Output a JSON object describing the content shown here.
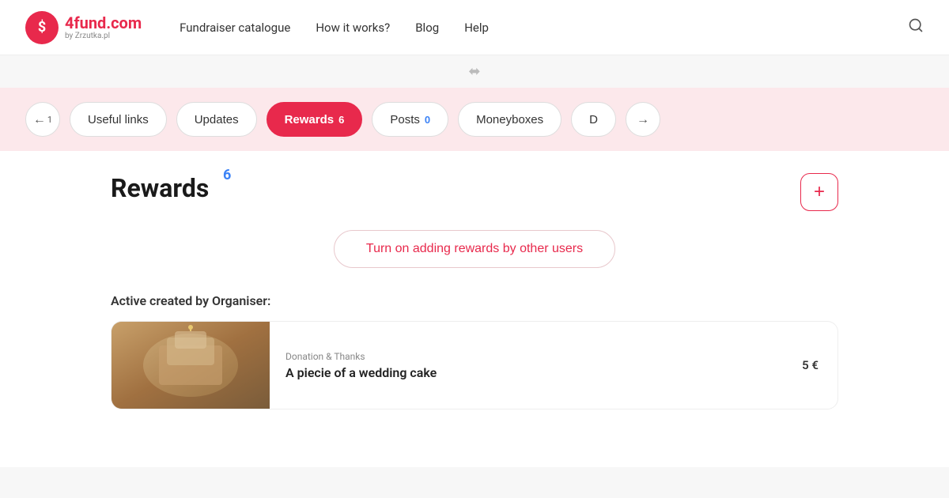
{
  "logo": {
    "icon_text": "$",
    "main_text_black": "4fund",
    "main_text_accent": ".com",
    "sub_text": "by Zrzutka.pl"
  },
  "nav": {
    "links": [
      "Fundraiser catalogue",
      "How it works?",
      "Blog",
      "Help"
    ]
  },
  "scroll_indicator": "⇅",
  "tabs": {
    "prev_arrow": "←",
    "next_arrow": "→",
    "items": [
      {
        "label": "1",
        "count": null,
        "active": false,
        "arrow": "← 1"
      },
      {
        "label": "Useful links",
        "count": null,
        "active": false
      },
      {
        "label": "Updates",
        "count": null,
        "active": false
      },
      {
        "label": "Rewards",
        "count": "6",
        "active": true
      },
      {
        "label": "Posts",
        "count": "0",
        "active": false,
        "count_color": "blue"
      },
      {
        "label": "Moneyboxes",
        "count": null,
        "active": false
      },
      {
        "label": "D",
        "count": null,
        "active": false,
        "arrow": "→"
      }
    ]
  },
  "rewards_section": {
    "title": "Rewards",
    "count": "6",
    "add_button_label": "+",
    "turn_on_label": "Turn on adding rewards by other users",
    "section_subtitle": "Active created by Organiser:",
    "reward_card": {
      "category": "Donation & Thanks",
      "name": "A piecie of a wedding cake",
      "price": "5 €"
    }
  }
}
